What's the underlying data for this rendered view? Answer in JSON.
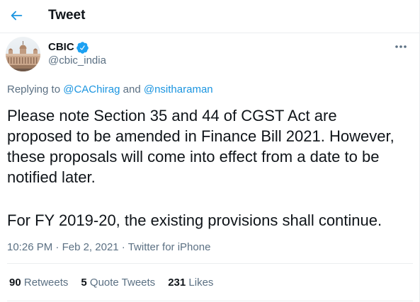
{
  "header": {
    "title": "Tweet",
    "back_icon": "arrow-left-icon"
  },
  "author": {
    "name": "CBIC",
    "handle": "@cbic_india",
    "verified": true,
    "verified_icon": "verified-badge-icon",
    "more_icon": "more-horizontal-icon"
  },
  "reply_context": {
    "prefix": "Replying to",
    "mentions": [
      "@CAChirag",
      "@nsitharaman"
    ],
    "conjunction": "and"
  },
  "tweet": {
    "paragraphs": [
      [
        "Please note Section 35 and 44 of CGST Act are",
        "proposed to be amended in Finance Bill 2021. However,",
        "these proposals will come into effect from a date to be",
        "notified later."
      ],
      [
        "For FY 2019-20, the existing provisions shall continue."
      ]
    ]
  },
  "meta": {
    "time": "10:26 PM",
    "separator": "·",
    "date": "Feb 2, 2021",
    "source": "Twitter for iPhone"
  },
  "stats": [
    {
      "count": 90,
      "label": "Retweets"
    },
    {
      "count": 5,
      "label": "Quote Tweets"
    },
    {
      "count": 231,
      "label": "Likes"
    }
  ],
  "colors": {
    "text": "#0f1419",
    "secondary": "#5b7083",
    "accent": "#1b95e0",
    "verified": "#1da1f2",
    "border": "#ebeef0"
  }
}
